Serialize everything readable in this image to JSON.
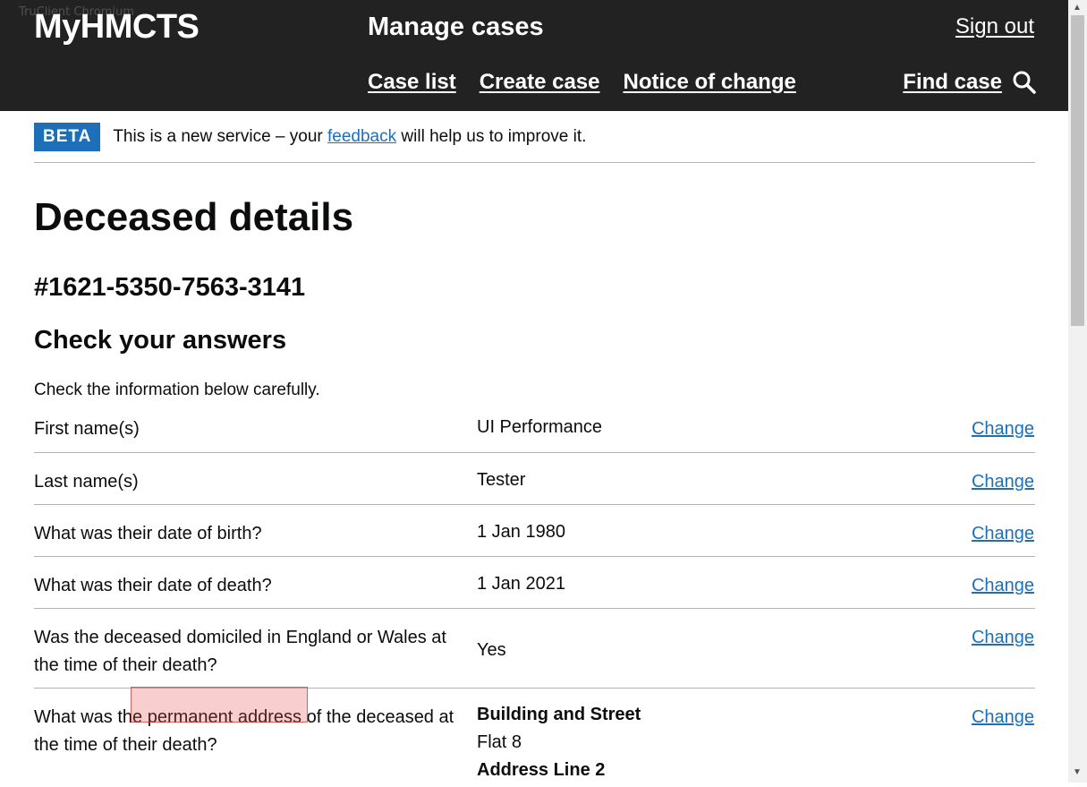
{
  "window_title": "TruClient Chromium",
  "header": {
    "logo": "MyHMCTS",
    "service_name": "Manage cases",
    "sign_out": "Sign out",
    "nav": [
      "Case list",
      "Create case",
      "Notice of change"
    ],
    "find_case": "Find case"
  },
  "beta": {
    "tag": "BETA",
    "text_before": "This is a new service – your ",
    "link": "feedback",
    "text_after": " will help us to improve it."
  },
  "page": {
    "title": "Deceased details",
    "case_ref": "#1621-5350-7563-3141",
    "subtitle": "Check your answers",
    "intro": "Check the information below carefully."
  },
  "answers": [
    {
      "question": "First name(s)",
      "answer": "UI Performance",
      "change": "Change"
    },
    {
      "question": "Last name(s)",
      "answer": "Tester",
      "change": "Change"
    },
    {
      "question": "What was their date of birth?",
      "answer": "1 Jan 1980",
      "change": "Change"
    },
    {
      "question": "What was their date of death?",
      "answer": "1 Jan 2021",
      "change": "Change"
    },
    {
      "question": "Was the deceased domiciled in England or Wales at the time of their death?",
      "answer": "Yes",
      "change": "Change"
    },
    {
      "question": "What was the permanent address of the deceased at the time of their death?",
      "change": "Change",
      "address": {
        "label1": "Building and Street",
        "value1": "Flat 8",
        "label2": "Address Line 2"
      }
    }
  ],
  "colors": {
    "header_bg": "#222222",
    "link": "#1d70b8",
    "beta_tag": "#1d70b8",
    "highlight": "#e65050"
  },
  "icons": {
    "find_case": "search-icon"
  }
}
